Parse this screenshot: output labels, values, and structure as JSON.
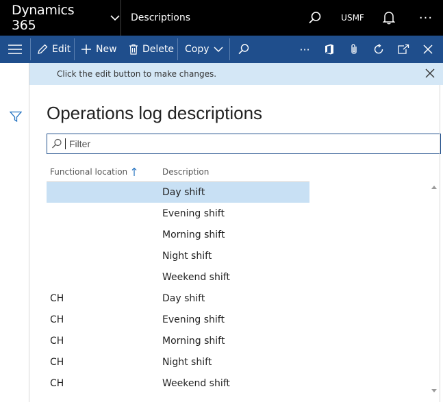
{
  "topbar": {
    "brand": "Dynamics 365",
    "breadcrumb": "Descriptions",
    "company": "USMF",
    "more": "···"
  },
  "actions": {
    "edit": "Edit",
    "new": "New",
    "delete": "Delete",
    "copy": "Copy",
    "more": "···"
  },
  "message": {
    "text": "Click the edit button to make changes."
  },
  "page": {
    "title": "Operations log descriptions",
    "filter_placeholder": "Filter"
  },
  "grid": {
    "columns": [
      "Functional location",
      "Description"
    ],
    "rows": [
      {
        "location": "",
        "description": "Day shift",
        "selected": true
      },
      {
        "location": "",
        "description": "Evening shift"
      },
      {
        "location": "",
        "description": "Morning shift"
      },
      {
        "location": "",
        "description": "Night shift"
      },
      {
        "location": "",
        "description": "Weekend shift"
      },
      {
        "location": "CH",
        "description": "Day shift"
      },
      {
        "location": "CH",
        "description": "Evening shift"
      },
      {
        "location": "CH",
        "description": "Morning shift"
      },
      {
        "location": "CH",
        "description": "Night shift"
      },
      {
        "location": "CH",
        "description": "Weekend shift"
      }
    ]
  },
  "colors": {
    "topbar": "#000000",
    "actionbar": "#1f4e8c",
    "messagebar": "#d4e7f6",
    "selected_row": "#c8e0f4"
  }
}
